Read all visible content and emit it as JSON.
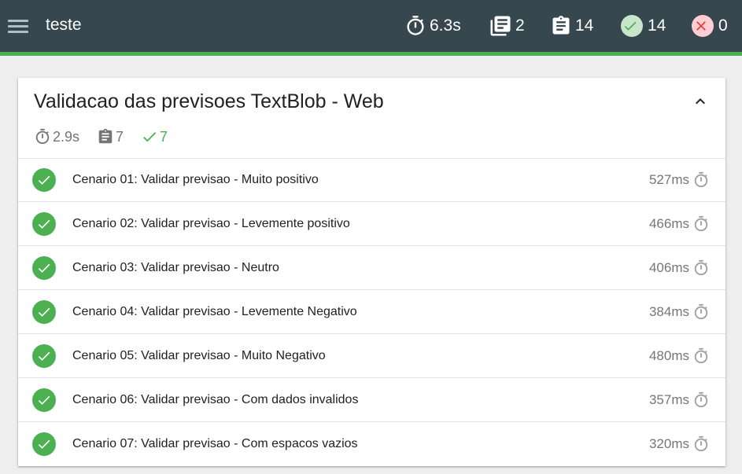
{
  "header": {
    "title": "teste",
    "duration": "6.3s",
    "features": "2",
    "scenarios": "14",
    "passed": "14",
    "failed": "0"
  },
  "colors": {
    "topbar": "#37474f",
    "accent": "#4caf50",
    "fail": "#e53935"
  },
  "feature": {
    "title": "Validacao das previsoes TextBlob - Web",
    "duration": "2.9s",
    "scenarios": "7",
    "passed": "7",
    "scenario_list": [
      {
        "name": "Cenario 01: Validar previsao - Muito positivo",
        "duration": "527ms",
        "status": "passed"
      },
      {
        "name": "Cenario 02: Validar previsao - Levemente positivo",
        "duration": "466ms",
        "status": "passed"
      },
      {
        "name": "Cenario 03: Validar previsao - Neutro",
        "duration": "406ms",
        "status": "passed"
      },
      {
        "name": "Cenario 04: Validar previsao - Levemente Negativo",
        "duration": "384ms",
        "status": "passed"
      },
      {
        "name": "Cenario 05: Validar previsao - Muito Negativo",
        "duration": "480ms",
        "status": "passed"
      },
      {
        "name": "Cenario 06: Validar previsao - Com dados invalidos",
        "duration": "357ms",
        "status": "passed"
      },
      {
        "name": "Cenario 07: Validar previsao - Com espacos vazios",
        "duration": "320ms",
        "status": "passed"
      }
    ]
  }
}
